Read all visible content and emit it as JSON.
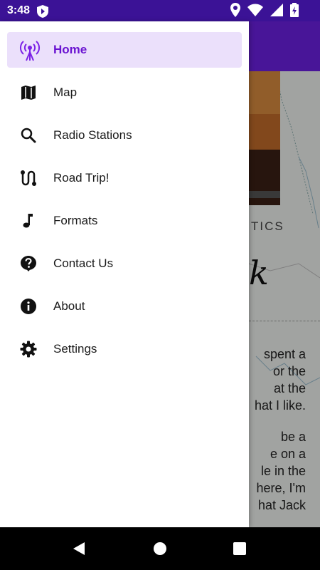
{
  "status_bar": {
    "time": "3:48",
    "icons": [
      "play-shield-icon",
      "location-icon",
      "wifi-icon",
      "signal-icon",
      "battery-icon"
    ]
  },
  "background_app": {
    "tab_label": "TICS",
    "script_text": "k",
    "paragraph_1": [
      "spent a",
      "or the",
      "at the",
      "hat I like."
    ],
    "paragraph_2": [
      "be a",
      "e on a",
      "le in the",
      "here, I'm",
      "hat Jack"
    ]
  },
  "drawer": {
    "items": [
      {
        "label": "Home",
        "icon": "radio-antenna-icon",
        "active": true
      },
      {
        "label": "Map",
        "icon": "map-icon",
        "active": false
      },
      {
        "label": "Radio Stations",
        "icon": "search-icon",
        "active": false
      },
      {
        "label": "Road Trip!",
        "icon": "route-icon",
        "active": false
      },
      {
        "label": "Formats",
        "icon": "music-note-icon",
        "active": false
      },
      {
        "label": "Contact Us",
        "icon": "help-icon",
        "active": false
      },
      {
        "label": "About",
        "icon": "info-icon",
        "active": false
      },
      {
        "label": "Settings",
        "icon": "gear-icon",
        "active": false
      }
    ]
  },
  "colors": {
    "status_bar": "#3b1296",
    "accent": "#6a13d1",
    "active_bg": "#ebe0fb"
  },
  "nav_bar": {
    "icons": [
      "back-icon",
      "home-icon",
      "recents-icon"
    ]
  }
}
